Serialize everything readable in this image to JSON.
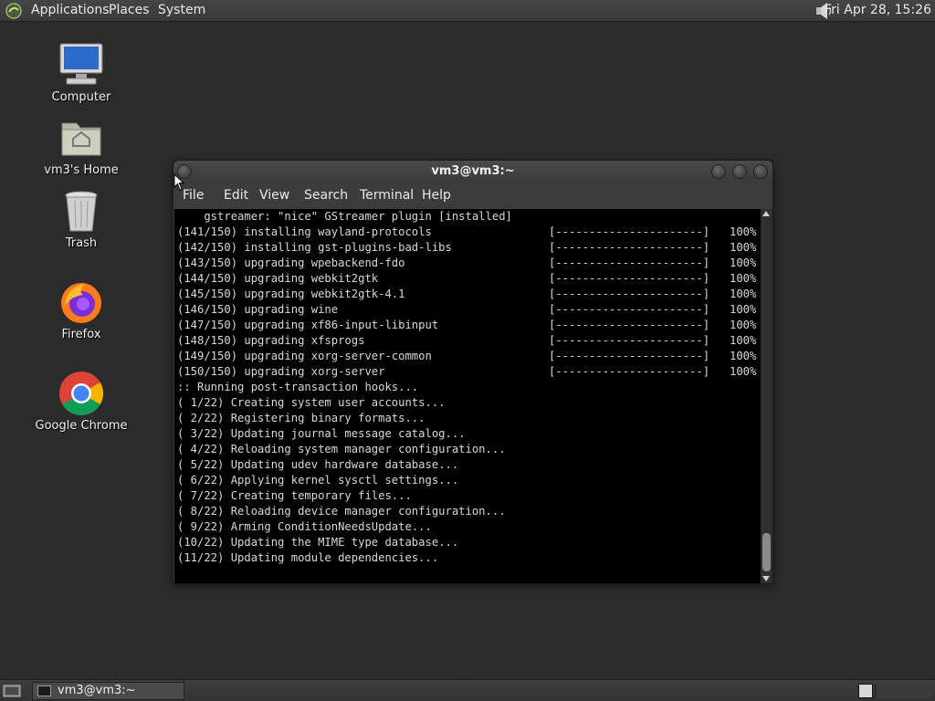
{
  "top_panel": {
    "menus": [
      "Applications",
      "Places",
      "System"
    ],
    "clock": "Fri Apr 28, 15:26",
    "icons": {
      "logo": "gnome-foot-icon",
      "volume": "speaker-icon"
    }
  },
  "desktop_icons": [
    {
      "label": "Computer",
      "icon": "computer-icon"
    },
    {
      "label": "vm3's Home",
      "icon": "home-folder-icon"
    },
    {
      "label": "Trash",
      "icon": "trash-icon"
    },
    {
      "label": "Firefox",
      "icon": "firefox-icon"
    },
    {
      "label": "Google Chrome",
      "icon": "chrome-icon"
    }
  ],
  "terminal": {
    "title": "vm3@vm3:~",
    "menu": [
      "File",
      "Edit",
      "View",
      "Search",
      "Terminal",
      "Help"
    ],
    "progress_bar": "[----------------------]",
    "lines": [
      {
        "text": "    gstreamer: \"nice\" GStreamer plugin [installed]"
      },
      {
        "text": "(141/150) installing wayland-protocols",
        "pct": "100%"
      },
      {
        "text": "(142/150) installing gst-plugins-bad-libs",
        "pct": "100%"
      },
      {
        "text": "(143/150) upgrading wpebackend-fdo",
        "pct": "100%"
      },
      {
        "text": "(144/150) upgrading webkit2gtk",
        "pct": "100%"
      },
      {
        "text": "(145/150) upgrading webkit2gtk-4.1",
        "pct": "100%"
      },
      {
        "text": "(146/150) upgrading wine",
        "pct": "100%"
      },
      {
        "text": "(147/150) upgrading xf86-input-libinput",
        "pct": "100%"
      },
      {
        "text": "(148/150) upgrading xfsprogs",
        "pct": "100%"
      },
      {
        "text": "(149/150) upgrading xorg-server-common",
        "pct": "100%"
      },
      {
        "text": "(150/150) upgrading xorg-server",
        "pct": "100%"
      },
      {
        "text": ":: Running post-transaction hooks..."
      },
      {
        "text": "( 1/22) Creating system user accounts..."
      },
      {
        "text": "( 2/22) Registering binary formats..."
      },
      {
        "text": "( 3/22) Updating journal message catalog..."
      },
      {
        "text": "( 4/22) Reloading system manager configuration..."
      },
      {
        "text": "( 5/22) Updating udev hardware database..."
      },
      {
        "text": "( 6/22) Applying kernel sysctl settings..."
      },
      {
        "text": "( 7/22) Creating temporary files..."
      },
      {
        "text": "( 8/22) Reloading device manager configuration..."
      },
      {
        "text": "( 9/22) Arming ConditionNeedsUpdate..."
      },
      {
        "text": "(10/22) Updating the MIME type database..."
      },
      {
        "text": "(11/22) Updating module dependencies..."
      }
    ]
  },
  "taskbar": {
    "items": [
      {
        "label": "vm3@vm3:~",
        "icon": "terminal-icon"
      }
    ]
  },
  "colors": {
    "desktop": "#2b2b2b",
    "panel": "#3d3d3d",
    "terminal_bg": "#000000",
    "terminal_fg": "#d8d8d8"
  }
}
